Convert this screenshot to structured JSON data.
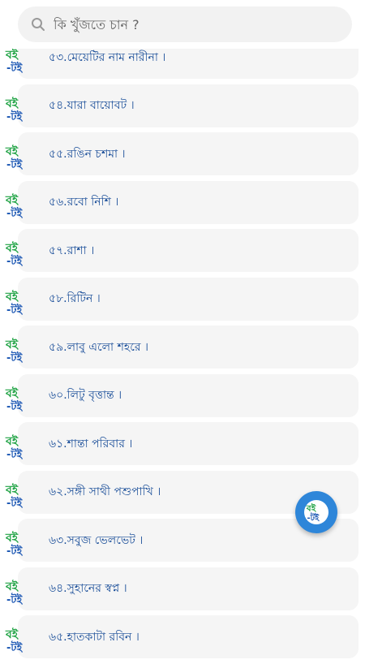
{
  "search": {
    "placeholder": "কি খুঁজতে চান ?"
  },
  "items": [
    {
      "label": "৫৩.মেয়েটির নাম নারীনা ।"
    },
    {
      "label": "৫৪.যারা বায়োবট ।"
    },
    {
      "label": "৫৫.রঙিন চশমা ।"
    },
    {
      "label": "৫৬.রবো নিশি ।"
    },
    {
      "label": "৫৭.রাশা ।"
    },
    {
      "label": "৫৮.রিটিন ।"
    },
    {
      "label": "৫৯.লাবু এলো শহরে ।"
    },
    {
      "label": "৬০.লিটু বৃত্তান্ত ।"
    },
    {
      "label": "৬১.শান্তা পরিবার ।"
    },
    {
      "label": "৬২.সঙ্গী সাথী পশুপাখি ।"
    },
    {
      "label": "৬৩.সবুজ ভেলভেট ।"
    },
    {
      "label": "৬৪.সুহানের স্বপ্ন ।"
    },
    {
      "label": "৬৫.হাতকাটা রবিন ।"
    }
  ],
  "logo_text": {
    "top": "বই",
    "bottom": "-টই"
  },
  "colors": {
    "label": "#1a4e99",
    "logo_green": "#23a447",
    "logo_blue": "#1a56b3",
    "fab": "#2e86d9"
  }
}
